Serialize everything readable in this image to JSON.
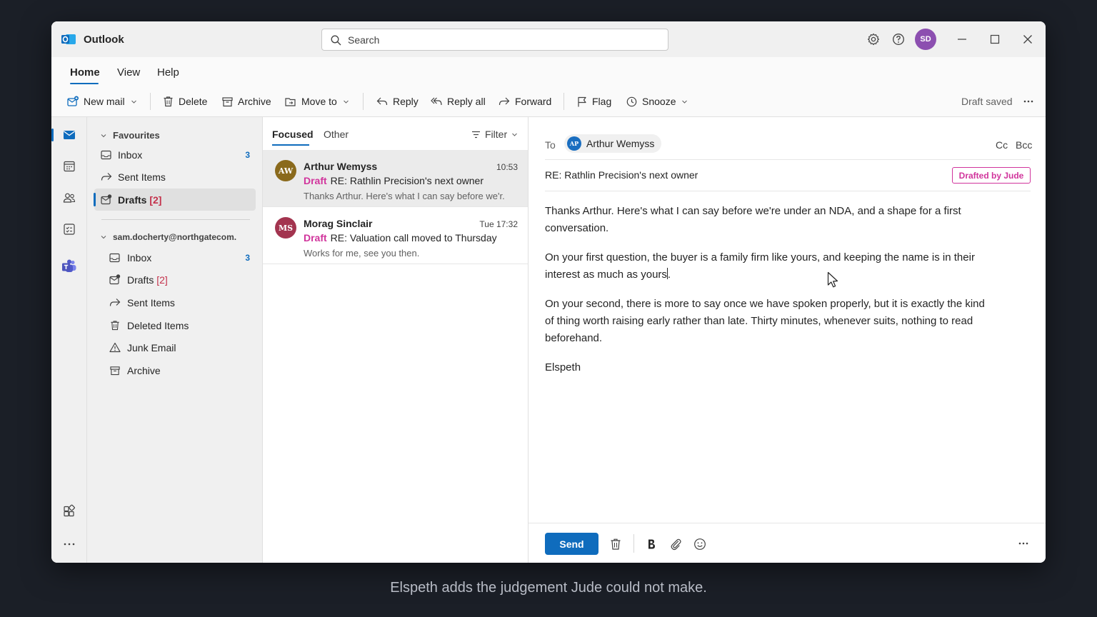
{
  "app": {
    "name": "Outlook",
    "brand_color": "#0f6cbd"
  },
  "search": {
    "placeholder": "Search"
  },
  "user": {
    "initials": "SD",
    "avatar_color": "#8c4fb0"
  },
  "ribbon": {
    "tabs": [
      "Home",
      "View",
      "Help"
    ],
    "active_tab": "Home",
    "buttons": {
      "new_mail": "New mail",
      "delete": "Delete",
      "archive": "Archive",
      "move_to": "Move to",
      "reply": "Reply",
      "reply_all": "Reply all",
      "forward": "Forward",
      "flag": "Flag",
      "snooze": "Snooze"
    },
    "status": "Draft saved"
  },
  "folders": {
    "favourites": {
      "label": "Favourites",
      "items": [
        {
          "label": "Inbox",
          "count": "3"
        },
        {
          "label": "Sent Items",
          "count": ""
        },
        {
          "label": "Drafts",
          "count": "[2]"
        }
      ]
    },
    "account": {
      "label": "sam.docherty@northgatecom.",
      "items": [
        {
          "label": "Inbox",
          "count": "3"
        },
        {
          "label": "Drafts",
          "count": "[2]"
        },
        {
          "label": "Sent Items",
          "count": ""
        },
        {
          "label": "Deleted Items",
          "count": ""
        },
        {
          "label": "Junk Email",
          "count": ""
        },
        {
          "label": "Archive",
          "count": ""
        }
      ]
    }
  },
  "message_list": {
    "tabs": [
      "Focused",
      "Other"
    ],
    "filter_label": "Filter",
    "draft_label": "Draft",
    "messages": [
      {
        "initials": "AW",
        "avatar_color": "#8a6a1c",
        "sender": "Arthur Wemyss",
        "time": "10:53",
        "subject": "RE: Rathlin Precision's next owner",
        "preview": "Thanks Arthur. Here's what I can say before we'r."
      },
      {
        "initials": "MS",
        "avatar_color": "#a3344f",
        "sender": "Morag Sinclair",
        "time": "Tue 17:32",
        "subject": "RE: Valuation call moved to Thursday",
        "preview": "Works for me, see you then."
      }
    ]
  },
  "compose": {
    "to_label": "To",
    "recipient": {
      "initials": "AP",
      "name": "Arthur Wemyss"
    },
    "cc_label": "Cc",
    "bcc_label": "Bcc",
    "subject": "RE: Rathlin Precision's next owner",
    "badge": "Drafted by Jude",
    "body": {
      "p1": "Thanks Arthur. Here's what I can say before we're under an NDA, and a shape for a first conversation.",
      "p2": "On your first question, the buyer is a family firm like yours, and keeping the name is in their interest as much as yours",
      "p2_end": ".",
      "p3": "On your second, there is more to say once we have spoken properly, but it is exactly the kind of thing worth raising early rather than late. Thirty minutes, whenever suits, nothing to read beforehand.",
      "signature": "Elspeth"
    },
    "send_label": "Send"
  },
  "caption": "Elspeth adds the judgement Jude could not make."
}
